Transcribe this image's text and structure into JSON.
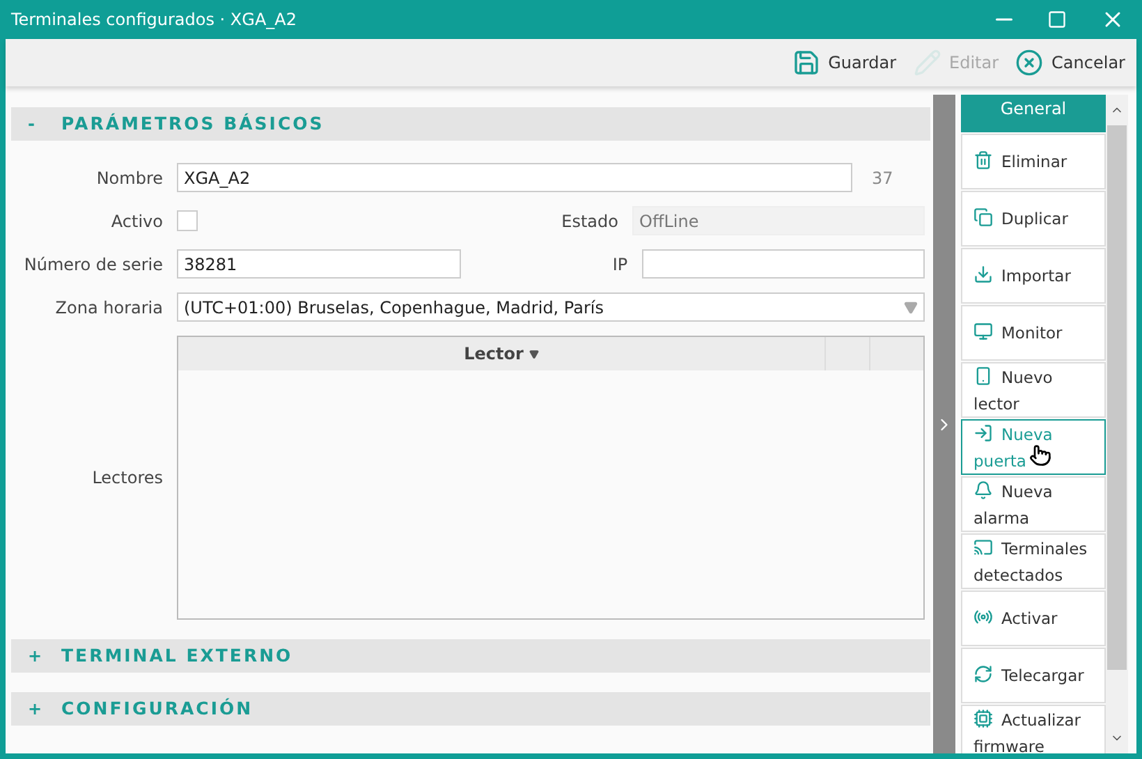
{
  "window": {
    "title": "Terminales configurados · XGA_A2"
  },
  "toolbar": [
    {
      "label": "Guardar",
      "kind": "save",
      "disabled": false
    },
    {
      "label": "Editar",
      "kind": "edit",
      "disabled": true
    },
    {
      "label": "Cancelar",
      "kind": "cancel",
      "disabled": false
    }
  ],
  "sections": [
    {
      "toggle": "-",
      "title": "PARÁMETROS BÁSICOS"
    },
    {
      "toggle": "+",
      "title": "TERMINAL EXTERNO"
    },
    {
      "toggle": "+",
      "title": "CONFIGURACIÓN"
    }
  ],
  "form": {
    "nombre": {
      "label": "Nombre",
      "value": "XGA_A2",
      "count": "37"
    },
    "activo": {
      "label": "Activo",
      "checked": false
    },
    "estado": {
      "label": "Estado",
      "value": "OffLine"
    },
    "numero_serie": {
      "label": "Número de serie",
      "value": "38281"
    },
    "ip": {
      "label": "IP"
    },
    "zona_horaria": {
      "label": "Zona horaria",
      "value": "(UTC+01:00) Bruselas, Copenhague, Madrid, París"
    },
    "lectores": {
      "label": "Lectores",
      "columns": [
        "Lector"
      ]
    }
  },
  "side_panel": {
    "title": "General",
    "items": [
      {
        "label": "Eliminar",
        "kind": "trash",
        "selected": false
      },
      {
        "label": "Duplicar",
        "kind": "copy",
        "selected": false
      },
      {
        "label": "Importar",
        "kind": "import",
        "selected": false
      },
      {
        "label": "Monitor",
        "kind": "monitor",
        "selected": false
      },
      {
        "label": "Nuevo lector",
        "kind": "reader",
        "selected": false
      },
      {
        "label": "Nueva puerta",
        "kind": "door",
        "selected": true
      },
      {
        "label": "Nueva alarma",
        "kind": "bell",
        "selected": false
      },
      {
        "label": "Terminales detectados",
        "kind": "cast",
        "selected": false
      },
      {
        "label": "Activar",
        "kind": "activate",
        "selected": false
      },
      {
        "label": "Telecargar",
        "kind": "reload",
        "selected": false
      },
      {
        "label": "Actualizar firmware",
        "kind": "chip",
        "selected": false
      }
    ]
  }
}
